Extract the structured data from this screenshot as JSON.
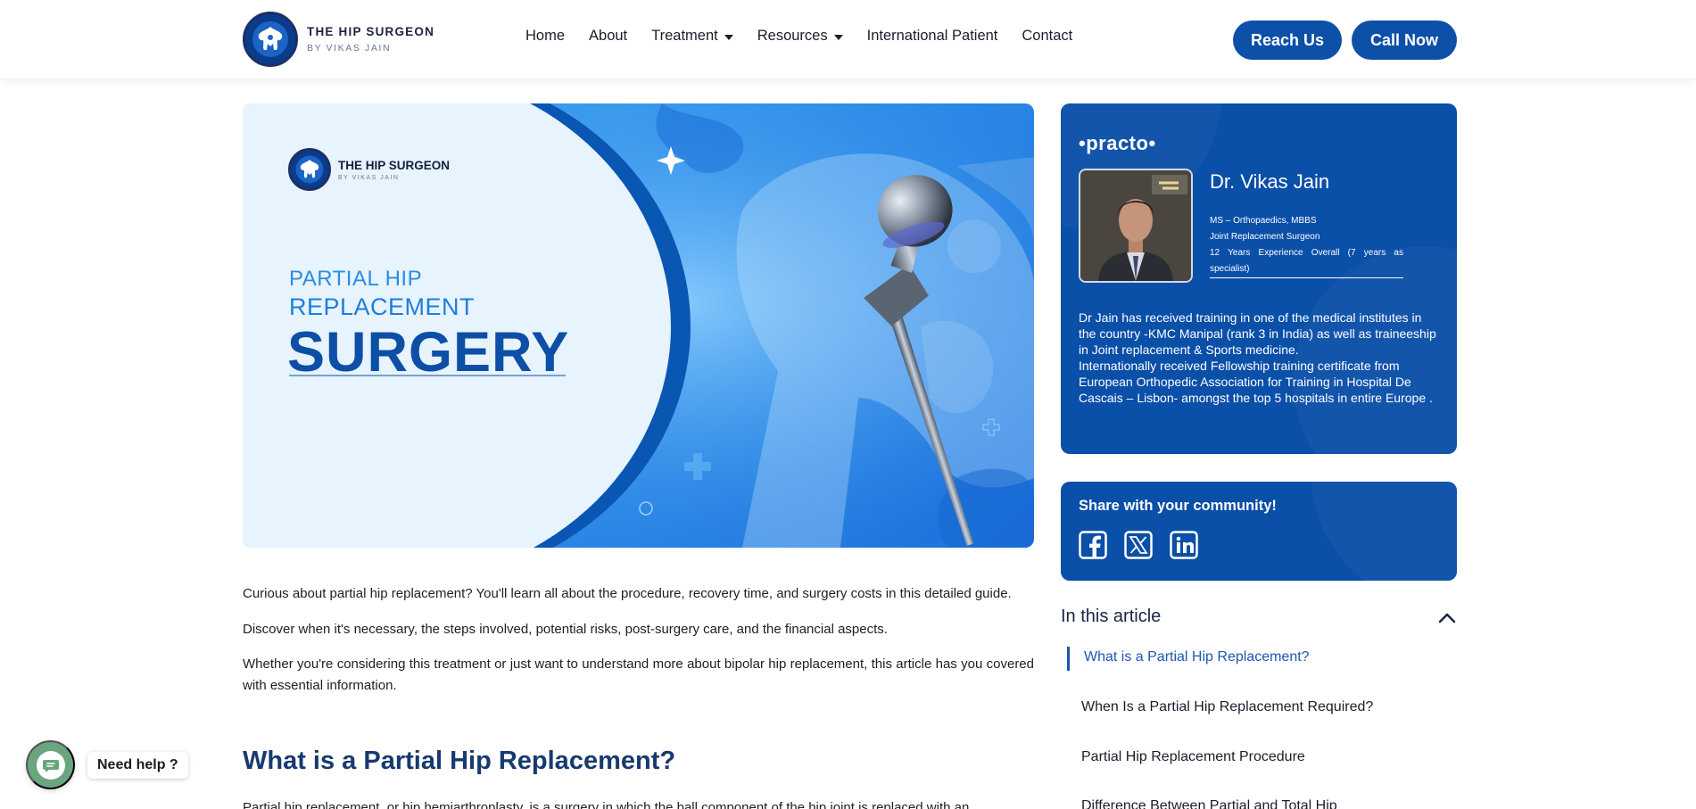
{
  "brand": {
    "title": "THE HIP SURGEON",
    "subtitle": "BY VIKAS JAIN"
  },
  "nav": {
    "items": [
      {
        "label": "Home",
        "has_menu": false
      },
      {
        "label": "About",
        "has_menu": false
      },
      {
        "label": "Treatment",
        "has_menu": true
      },
      {
        "label": "Resources",
        "has_menu": true
      },
      {
        "label": "International Patient",
        "has_menu": false
      },
      {
        "label": "Contact",
        "has_menu": false
      }
    ],
    "reach_us": "Reach Us",
    "call_now": "Call Now"
  },
  "hero": {
    "logo_title": "THE HIP SURGEON",
    "logo_subtitle": "BY VIKAS JAIN",
    "line1": "PARTIAL HIP",
    "line2": "REPLACEMENT",
    "line3": "SURGERY"
  },
  "article": {
    "intro": [
      "Curious about partial hip replacement? You'll learn all about the procedure, recovery time, and surgery costs in this detailed guide.",
      "Discover when it's necessary, the steps involved, potential risks, post-surgery care, and the financial aspects.",
      "Whether you're considering this treatment or just want to understand more about bipolar hip replacement, this article has you covered with essential information."
    ],
    "heading": "What is a Partial Hip Replacement?",
    "cut_paragraph": "Partial hip replacement, or hip hemiarthroplasty, is a surgery in which the ball component of the hip joint is replaced with an"
  },
  "doctor": {
    "brand": "•practo•",
    "name": "Dr. Vikas Jain",
    "degree": "MS – Orthopaedics, MBBS",
    "role": "Joint Replacement Surgeon",
    "experience": "12 Years Experience Overall  (7 years as specialist)",
    "bio": "Dr Jain has received training in one of the medical institutes in the country -KMC Manipal (rank 3 in India) as well as traineeship in Joint replacement & Sports medicine.\nInternationally received Fellowship training certificate from European Orthopedic Association for Training in Hospital De Cascais – Lisbon- amongst the top 5 hospitals in entire Europe ."
  },
  "share": {
    "title": "Share with your community!",
    "icons": [
      "facebook-icon",
      "x-twitter-icon",
      "linkedin-icon"
    ]
  },
  "toc": {
    "title": "In this article",
    "items": [
      "What is a Partial Hip Replacement?",
      "When Is a Partial Hip Replacement Required?",
      "Partial Hip Replacement Procedure",
      "Difference Between Partial and Total Hip"
    ],
    "active_index": 0
  },
  "help": {
    "label": "Need help ?"
  },
  "colors": {
    "primary": "#0c50a8",
    "heading": "#173a6f",
    "toc_active": "#1c56b0",
    "help_button": "#6aa57f"
  }
}
